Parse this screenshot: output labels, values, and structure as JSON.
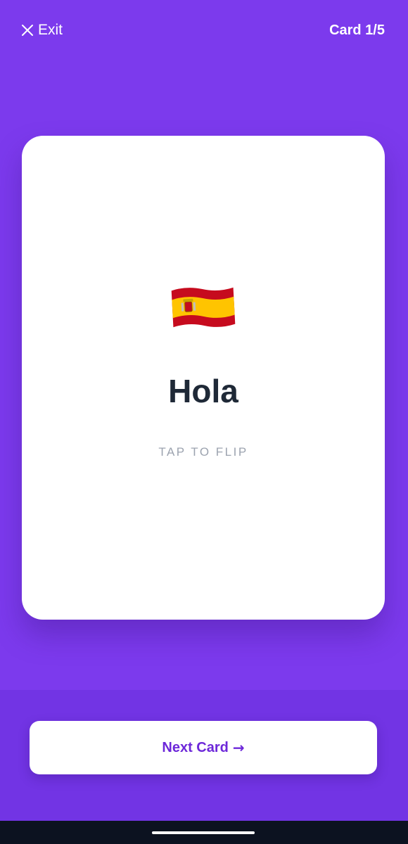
{
  "header": {
    "exit_label": "Exit",
    "exit_icon": "close-icon",
    "card_counter": "Card 1/5"
  },
  "card": {
    "flag_icon": "spain-flag-icon",
    "word": "Hola",
    "hint": "TAP TO FLIP"
  },
  "footer": {
    "next_label": "Next Card",
    "next_arrow": "→",
    "next_icon": "arrow-right-icon"
  },
  "colors": {
    "background": "#7c3aed",
    "footer_background": "#7234e4",
    "accent_text": "#6d28d9",
    "word_text": "#1f2937",
    "hint_text": "#9ca3af"
  }
}
